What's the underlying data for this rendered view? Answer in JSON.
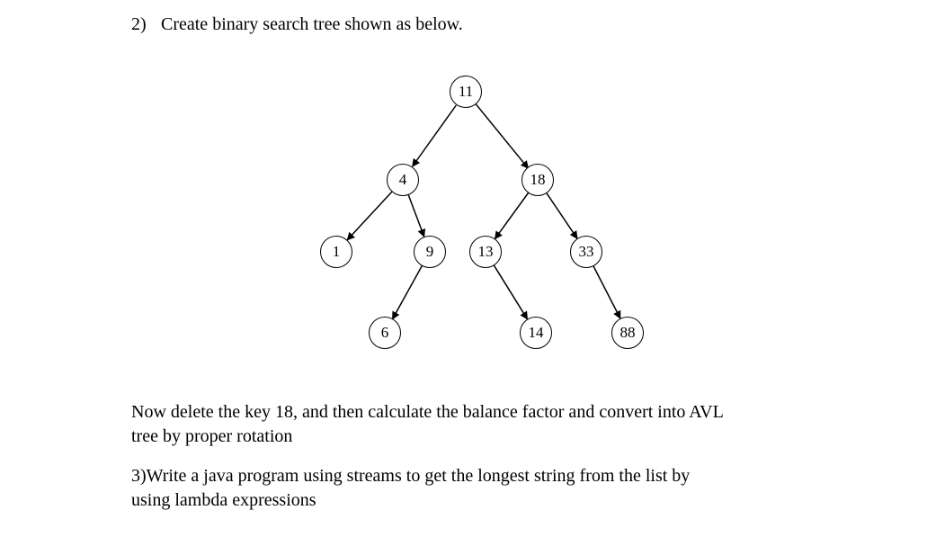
{
  "question2": {
    "number": "2)",
    "prompt": "Create binary search tree shown as below."
  },
  "tree": {
    "nodes": {
      "n11": "11",
      "n4": "4",
      "n18": "18",
      "n1": "1",
      "n9": "9",
      "n13": "13",
      "n33": "33",
      "n6": "6",
      "n14": "14",
      "n88": "88"
    }
  },
  "task_after_tree": {
    "line1": "Now delete the key 18, and then calculate the balance factor and convert into AVL",
    "line2": "tree by proper rotation"
  },
  "question3": {
    "number": "3)",
    "line1_rest": "Write a java program using streams to get the longest string from the list by",
    "line2": "using lambda expressions"
  },
  "chart_data": {
    "type": "tree",
    "description": "Binary search tree",
    "root": 11,
    "edges": [
      {
        "parent": 11,
        "child": 4,
        "side": "left"
      },
      {
        "parent": 11,
        "child": 18,
        "side": "right"
      },
      {
        "parent": 4,
        "child": 1,
        "side": "left"
      },
      {
        "parent": 4,
        "child": 9,
        "side": "right"
      },
      {
        "parent": 18,
        "child": 13,
        "side": "left"
      },
      {
        "parent": 18,
        "child": 33,
        "side": "right"
      },
      {
        "parent": 9,
        "child": 6,
        "side": "left"
      },
      {
        "parent": 13,
        "child": 14,
        "side": "right"
      },
      {
        "parent": 33,
        "child": 88,
        "side": "right"
      }
    ],
    "nodes": [
      11,
      4,
      18,
      1,
      9,
      13,
      33,
      6,
      14,
      88
    ]
  }
}
